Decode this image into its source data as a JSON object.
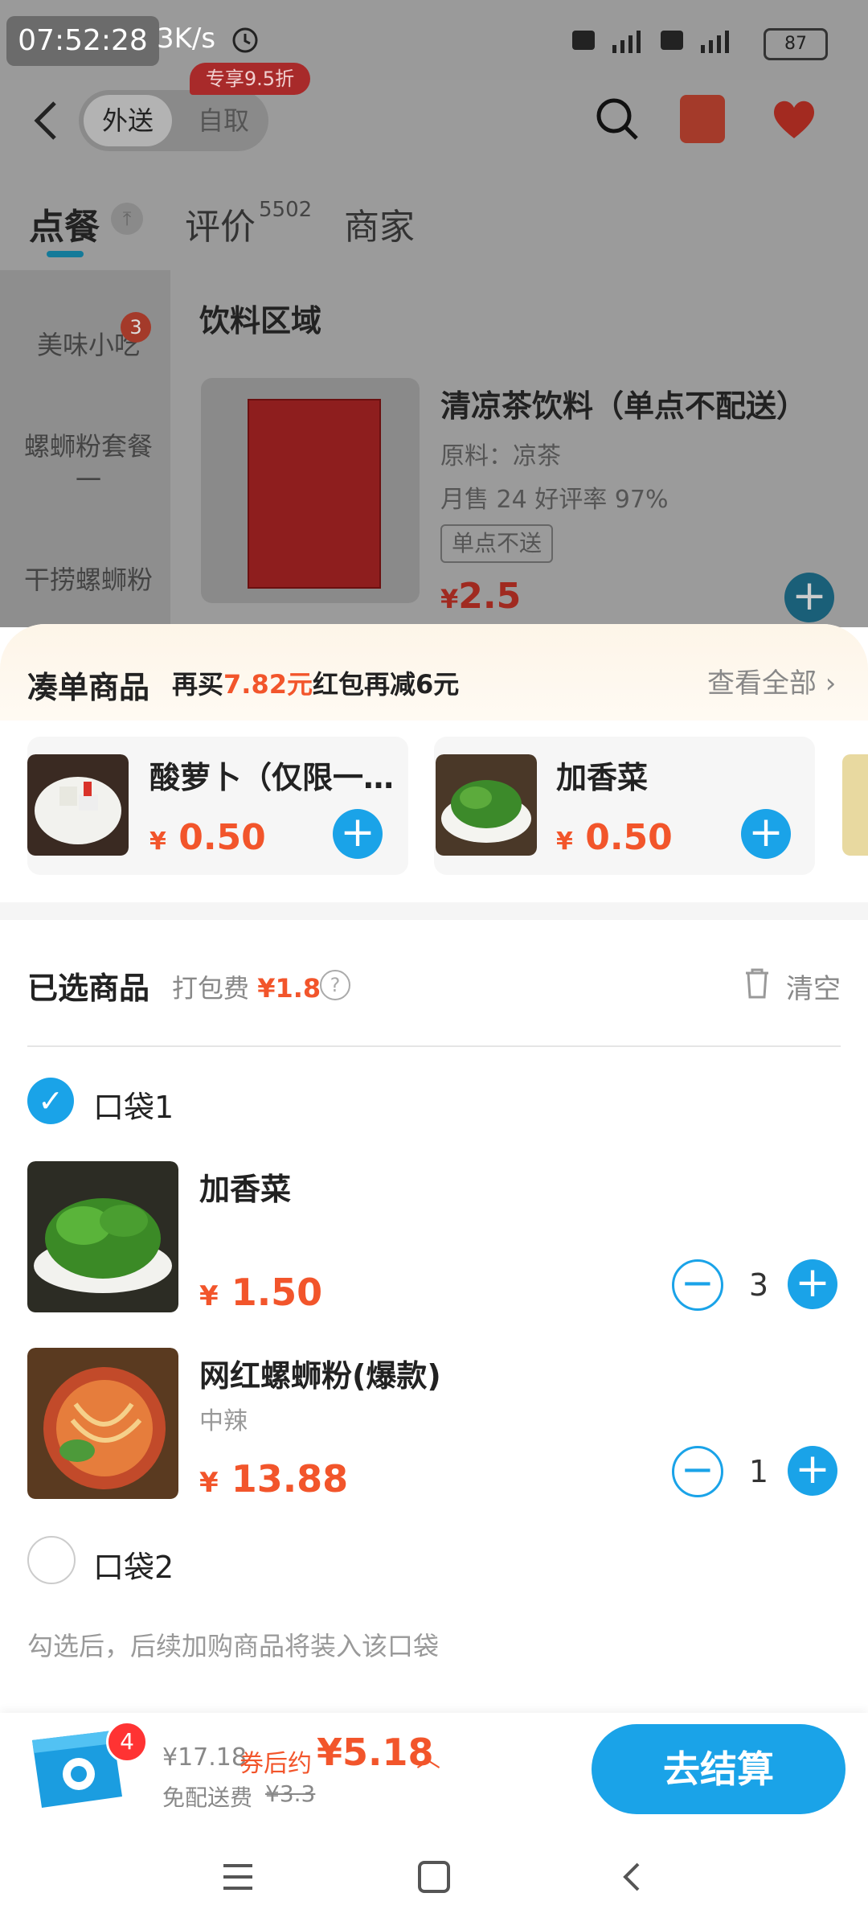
{
  "status_bar": {
    "time": "07:52:28",
    "speed": "3K/s",
    "battery": "87"
  },
  "header": {
    "tab_delivery": "外送",
    "tab_pickup": "自取",
    "promo_badge": "专享9.5折"
  },
  "nav_tabs": {
    "order": "点餐",
    "reviews": "评价",
    "reviews_count": "5502",
    "merchant": "商家"
  },
  "sidebar": {
    "items": [
      "美味小吃",
      "螺蛳粉套餐一",
      "干捞螺蛳粉"
    ],
    "badge": "3"
  },
  "section": {
    "title": "饮料区域",
    "product": {
      "name": "清凉茶饮料（单点不配送）",
      "ingredients": "原料：凉茶",
      "sales": "月售 24 好评率 97%",
      "tag": "单点不送",
      "currency": "¥",
      "price": "2.5"
    }
  },
  "addon": {
    "title": "凑单商品",
    "desc_prefix": "再买",
    "desc_amount": "7.82元",
    "desc_suffix": "红包再减6元",
    "view_all": "查看全部",
    "items": [
      {
        "name": "酸萝卜（仅限一…",
        "currency": "¥",
        "price": "0.50"
      },
      {
        "name": "加香菜",
        "currency": "¥",
        "price": "0.50"
      }
    ]
  },
  "selected": {
    "title": "已选商品",
    "fee_label": "打包费",
    "fee_value": "¥1.8",
    "clear_label": "清空",
    "bag1": "口袋1",
    "bag2": "口袋2",
    "items": [
      {
        "name": "加香菜",
        "spec": "",
        "currency": "¥",
        "price": "1.50",
        "qty": "3"
      },
      {
        "name": "网红螺蛳粉(爆款)",
        "spec": "中辣",
        "currency": "¥",
        "price": "13.88",
        "qty": "1"
      }
    ],
    "bag_hint": "勾选后，后续加购商品将装入该口袋"
  },
  "checkout": {
    "cart_count": "4",
    "original_total": "¥17.18",
    "after_coupon_label": "券后约",
    "final_total": "¥5.18",
    "free_shipping_label": "免配送费",
    "shipping_strike": "¥3.3",
    "button": "去结算"
  },
  "colors": {
    "accent_blue": "#1aa3e8",
    "price_red": "#f2552b"
  }
}
